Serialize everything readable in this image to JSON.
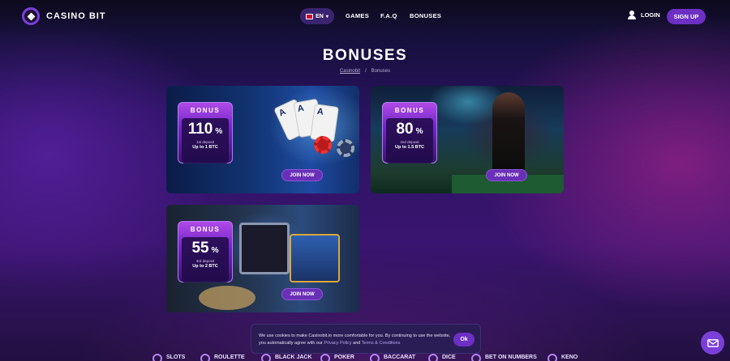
{
  "header": {
    "logo_text": "CASINO BIT",
    "language": "EN",
    "nav": [
      "GAMES",
      "F.A.Q",
      "BONUSES"
    ],
    "login": "LOGIN",
    "signup": "SIGN UP"
  },
  "page": {
    "title": "BONUSES",
    "breadcrumb": {
      "home": "Casinobit",
      "separator": "/",
      "current": "Bonuses"
    }
  },
  "bonuses": [
    {
      "label": "BONUS",
      "percent": "110",
      "percent_sign": "%",
      "deposit": "1st deposit",
      "up_to": "Up to 1 BTC",
      "button": "JOIN NOW"
    },
    {
      "label": "BONUS",
      "percent": "80",
      "percent_sign": "%",
      "deposit": "2nd deposit",
      "up_to": "Up to 1.5 BTC",
      "button": "JOIN NOW"
    },
    {
      "label": "BONUS",
      "percent": "55",
      "percent_sign": "%",
      "deposit": "3rd deposit",
      "up_to": "Up to 2 BTC",
      "button": "JOIN NOW"
    }
  ],
  "cookie": {
    "text_1": "We use cookies to make Casinobit.io more comfortable for you. By continuing to use the website, you automatically agree with our",
    "privacy": "Privacy Policy",
    "and": "and",
    "terms": "Terms & Conditions",
    "ok": "Ok"
  },
  "bottom_nav": [
    "SLOTS",
    "ROULETTE",
    "BLACK JACK",
    "POKER",
    "BACCARAT",
    "DICE",
    "BET ON NUMBERS",
    "KENO"
  ],
  "colors": {
    "accent": "#6d2fc4",
    "badge": "#7426c8"
  }
}
